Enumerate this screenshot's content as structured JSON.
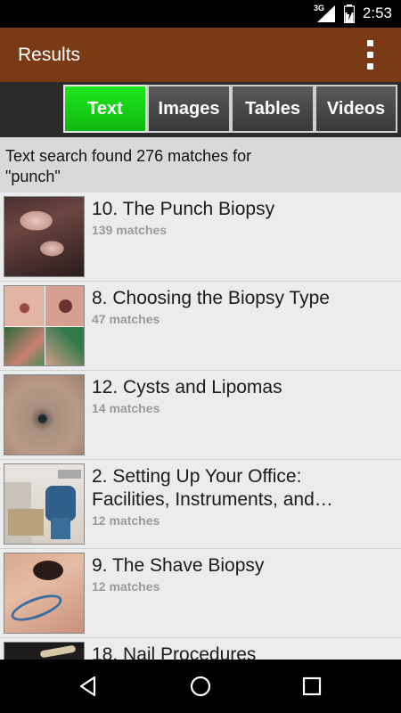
{
  "status": {
    "time": "2:53",
    "network": "3G"
  },
  "app_bar": {
    "title": "Results"
  },
  "tabs": [
    {
      "label": "Text",
      "active": true
    },
    {
      "label": "Images",
      "active": false
    },
    {
      "label": "Tables",
      "active": false
    },
    {
      "label": "Videos",
      "active": false
    }
  ],
  "summary": {
    "line1": "Text search found 276 matches for",
    "line2": "\"punch\""
  },
  "results": [
    {
      "title": "10. The Punch Biopsy",
      "count": "139 matches"
    },
    {
      "title": "8. Choosing the Biopsy Type",
      "count": "47 matches"
    },
    {
      "title": "12. Cysts and Lipomas",
      "count": "14 matches"
    },
    {
      "title_line1": "2. Setting Up Your Office:",
      "title_line2": "Facilities, Instruments, and…",
      "count": "12 matches"
    },
    {
      "title": "9. The Shave Biopsy",
      "count": "12 matches"
    },
    {
      "title": "18. Nail Procedures",
      "count": ""
    }
  ],
  "colors": {
    "app_bar": "#7b3a16",
    "active_tab": "#13c813",
    "status_bar": "#000000"
  }
}
